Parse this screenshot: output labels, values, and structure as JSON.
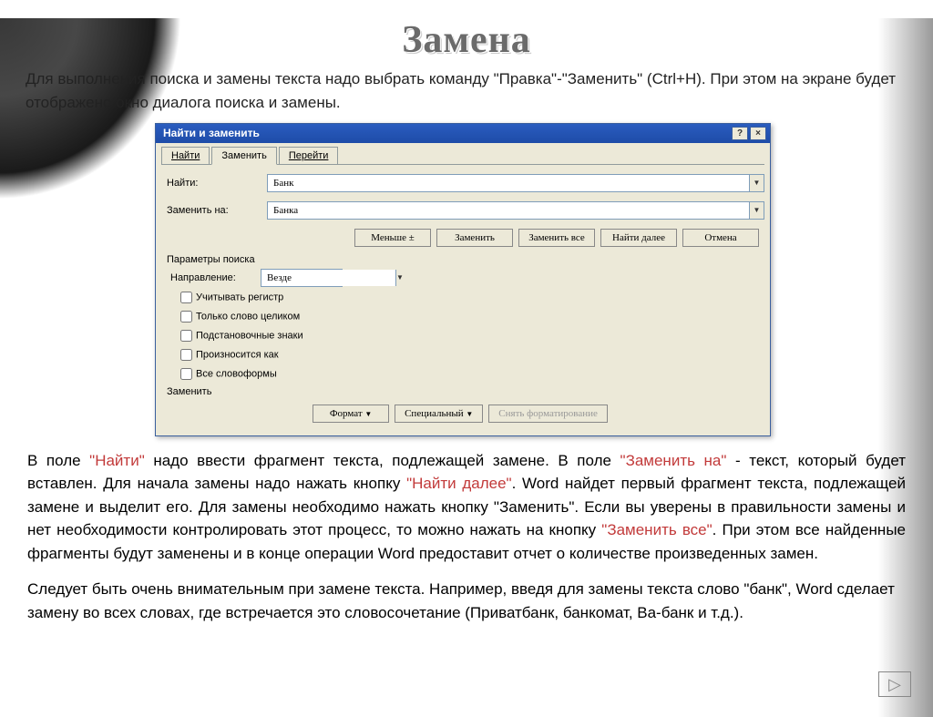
{
  "title": "Замена",
  "intro": "Для выполнения поиска и замены текста надо выбрать команду \"Правка\"-\"Заменить\" (Ctrl+H). При этом на экране будет отображено окно диалога поиска и замены.",
  "dialog": {
    "windowTitle": "Найти и заменить",
    "helpGlyph": "?",
    "closeGlyph": "×",
    "tabs": {
      "find": "Найти",
      "replace": "Заменить",
      "goto": "Перейти"
    },
    "labels": {
      "find": "Найти:",
      "replaceWith": "Заменить на:"
    },
    "values": {
      "find": "Банк",
      "replaceWith": "Банка"
    },
    "buttons": {
      "less": "Меньше ±",
      "replace": "Заменить",
      "replaceAll": "Заменить все",
      "findNext": "Найти далее",
      "cancel": "Отмена",
      "format": "Формат",
      "special": "Специальный",
      "clearFormatting": "Снять форматирование"
    },
    "paramsTitle": "Параметры поиска",
    "direction": {
      "label": "Направление:",
      "value": "Везде"
    },
    "checks": {
      "matchCase": "Учитывать регистр",
      "wholeWord": "Только слово целиком",
      "wildcards": "Подстановочные знаки",
      "soundsLike": "Произносится как",
      "wordForms": "Все словоформы"
    },
    "replaceGroup": "Заменить"
  },
  "explain": {
    "prefix": "В поле ",
    "f1": "\"Найти\"",
    "t1": " надо ввести фрагмент текста, подлежащей замене. В поле ",
    "f2": "\"Заменить на\"",
    "t2": " - текст, который будет вставлен. Для начала замены надо нажать кнопку ",
    "f3": "\"Найти далее\"",
    "t3": ". Word найдет первый фрагмент текста, подлежащей замене и выделит его. Для замены необходимо нажать кнопку \"Заменить\". Если вы уверены в правильности замены и нет необходимости контролировать этот процесс, то можно нажать на кнопку ",
    "f4": "\"Заменить все\"",
    "t4": ". При этом все найденные фрагменты будут заменены и в конце операции Word предоставит отчет о количестве произведенных замен."
  },
  "warn": "Следует быть очень внимательным при замене текста. Например, введя для замены текста слово \"банк\", Word сделает замену во всех словах, где встречается это словосочетание (Приватбанк, банкомат, Ва-банк и т.д.).",
  "nav": {
    "nextGlyph": "▷"
  }
}
